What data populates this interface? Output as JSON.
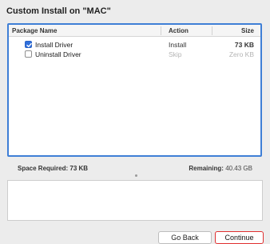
{
  "window": {
    "title": "Custom Install on \"MAC\""
  },
  "table": {
    "headers": {
      "name": "Package Name",
      "action": "Action",
      "size": "Size"
    },
    "rows": [
      {
        "name": "Install Driver",
        "action": "Install",
        "size": "73 KB",
        "checked": true,
        "enabled": true
      },
      {
        "name": "Uninstall Driver",
        "action": "Skip",
        "size": "Zero KB",
        "checked": false,
        "enabled": false
      }
    ]
  },
  "summary": {
    "space_required_label": "Space Required:",
    "space_required_value": "73 KB",
    "remaining_label": "Remaining:",
    "remaining_value": "40.43 GB"
  },
  "buttons": {
    "back": "Go Back",
    "continue": "Continue"
  },
  "colors": {
    "accent": "#3f7fd6",
    "checkbox": "#2f6fdc",
    "focus_highlight": "#e03030"
  }
}
